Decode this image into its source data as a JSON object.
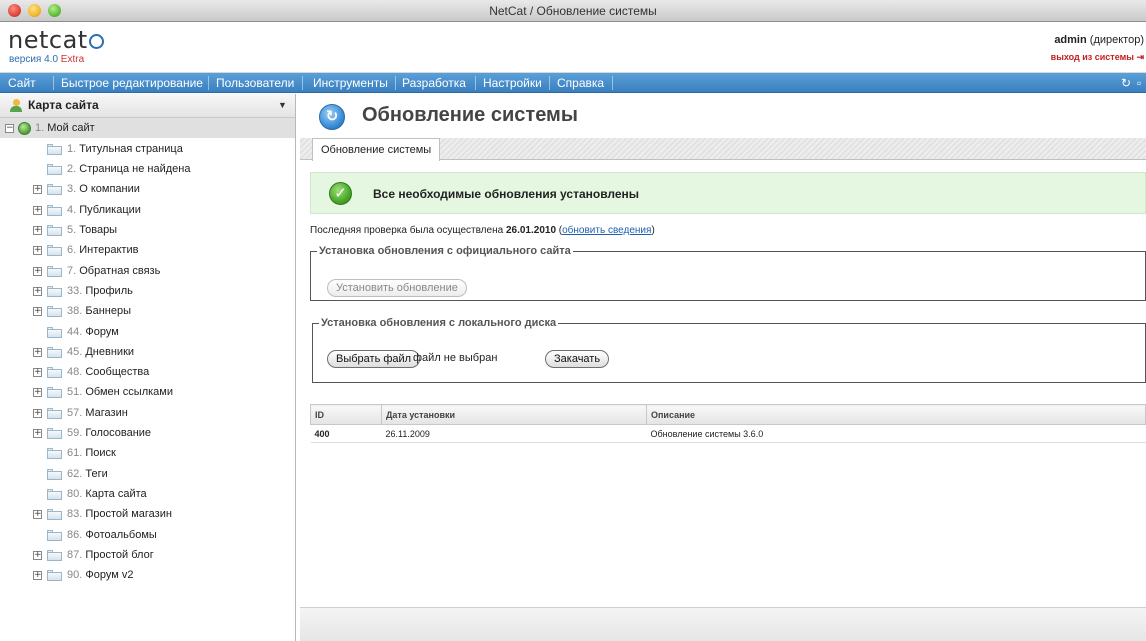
{
  "window": {
    "title": "NetCat / Обновление системы"
  },
  "header": {
    "logo_text": "netcat",
    "version_prefix": "версия 4.0",
    "version_edition": "Extra",
    "user_name": "admin",
    "user_role": "(директор)",
    "logout_label": "выход из системы"
  },
  "menu": {
    "items": [
      {
        "label": "Сайт"
      },
      {
        "label": "Быстрое редактирование"
      },
      {
        "label": "Пользователи"
      },
      {
        "label": "Инструменты"
      },
      {
        "label": "Разработка"
      },
      {
        "label": "Настройки"
      },
      {
        "label": "Справка"
      }
    ]
  },
  "sidebar": {
    "title": "Карта сайта",
    "tree": [
      {
        "num": "1.",
        "label": "Мой сайт"
      },
      {
        "num": "1.",
        "label": "Титульная страница"
      },
      {
        "num": "2.",
        "label": "Страница не найдена"
      },
      {
        "num": "3.",
        "label": "О компании"
      },
      {
        "num": "4.",
        "label": "Публикации"
      },
      {
        "num": "5.",
        "label": "Товары"
      },
      {
        "num": "6.",
        "label": "Интерактив"
      },
      {
        "num": "7.",
        "label": "Обратная связь"
      },
      {
        "num": "33.",
        "label": "Профиль"
      },
      {
        "num": "38.",
        "label": "Баннеры"
      },
      {
        "num": "44.",
        "label": "Форум"
      },
      {
        "num": "45.",
        "label": "Дневники"
      },
      {
        "num": "48.",
        "label": "Сообщества"
      },
      {
        "num": "51.",
        "label": "Обмен ссылками"
      },
      {
        "num": "57.",
        "label": "Магазин"
      },
      {
        "num": "59.",
        "label": "Голосование"
      },
      {
        "num": "61.",
        "label": "Поиск"
      },
      {
        "num": "62.",
        "label": "Теги"
      },
      {
        "num": "80.",
        "label": "Карта сайта"
      },
      {
        "num": "83.",
        "label": "Простой магазин"
      },
      {
        "num": "86.",
        "label": "Фотоальбомы"
      },
      {
        "num": "87.",
        "label": "Простой блог"
      },
      {
        "num": "90.",
        "label": "Форум v2"
      }
    ]
  },
  "main": {
    "title": "Обновление системы",
    "tab_label": "Обновление системы",
    "success_message": "Все необходимые обновления установлены",
    "lastcheck_prefix": "Последняя проверка была осуществлена",
    "lastcheck_date": "26.01.2010",
    "refresh_link": "обновить сведения",
    "official_group_legend": "Установка обновления с официального сайта",
    "install_button": "Установить обновление",
    "local_group_legend": "Установка обновления с локального диска",
    "choose_file_button": "Выбрать файл",
    "no_file_text": "файл не выбран",
    "upload_button": "Закачать",
    "table": {
      "headers": [
        "ID",
        "Дата установки",
        "Описание"
      ],
      "rows": [
        [
          "400",
          "26.11.2009",
          "Обновление системы 3.6.0"
        ]
      ]
    }
  },
  "colors": {
    "menu_bar": "#3a7fbf",
    "success_background": "#e5f7e1",
    "brand_blue": "#2a6db3",
    "logout_red": "#c32020"
  },
  "icons": {
    "sitemap": "user-tree-icon",
    "page": "refresh-icon",
    "success": "checkmark-icon",
    "tree_root": "globe-icon",
    "tree_node": "folder-icon",
    "logout": "exit-icon"
  }
}
